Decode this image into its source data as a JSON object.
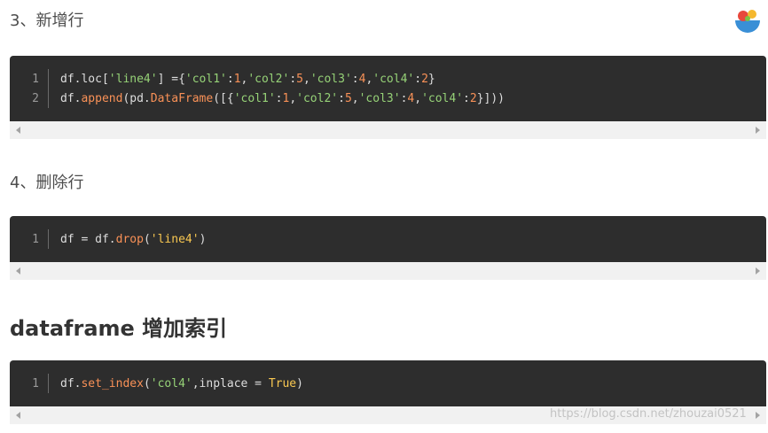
{
  "headings": {
    "step3": "3、新增行",
    "step4": "4、删除行",
    "section_index": "dataframe 增加索引"
  },
  "code_blocks": [
    {
      "lines": [
        {
          "number": "1",
          "tokens": [
            {
              "t": "df.loc[",
              "k": "plain"
            },
            {
              "t": "'line4'",
              "k": "str"
            },
            {
              "t": "] ={",
              "k": "plain"
            },
            {
              "t": "'col1'",
              "k": "str"
            },
            {
              "t": ":",
              "k": "plain"
            },
            {
              "t": "1",
              "k": "num"
            },
            {
              "t": ",",
              "k": "plain"
            },
            {
              "t": "'col2'",
              "k": "str"
            },
            {
              "t": ":",
              "k": "plain"
            },
            {
              "t": "5",
              "k": "num"
            },
            {
              "t": ",",
              "k": "plain"
            },
            {
              "t": "'col3'",
              "k": "str"
            },
            {
              "t": ":",
              "k": "plain"
            },
            {
              "t": "4",
              "k": "num"
            },
            {
              "t": ",",
              "k": "plain"
            },
            {
              "t": "'col4'",
              "k": "str"
            },
            {
              "t": ":",
              "k": "plain"
            },
            {
              "t": "2",
              "k": "num"
            },
            {
              "t": "}",
              "k": "plain"
            }
          ]
        },
        {
          "number": "2",
          "tokens": [
            {
              "t": "df.",
              "k": "plain"
            },
            {
              "t": "append",
              "k": "fn"
            },
            {
              "t": "(pd.",
              "k": "plain"
            },
            {
              "t": "DataFrame",
              "k": "fn"
            },
            {
              "t": "([{",
              "k": "plain"
            },
            {
              "t": "'col1'",
              "k": "str"
            },
            {
              "t": ":",
              "k": "plain"
            },
            {
              "t": "1",
              "k": "num"
            },
            {
              "t": ",",
              "k": "plain"
            },
            {
              "t": "'col2'",
              "k": "str"
            },
            {
              "t": ":",
              "k": "plain"
            },
            {
              "t": "5",
              "k": "num"
            },
            {
              "t": ",",
              "k": "plain"
            },
            {
              "t": "'col3'",
              "k": "str"
            },
            {
              "t": ":",
              "k": "plain"
            },
            {
              "t": "4",
              "k": "num"
            },
            {
              "t": ",",
              "k": "plain"
            },
            {
              "t": "'col4'",
              "k": "str"
            },
            {
              "t": ":",
              "k": "plain"
            },
            {
              "t": "2",
              "k": "num"
            },
            {
              "t": "}]))",
              "k": "plain"
            }
          ]
        }
      ]
    },
    {
      "lines": [
        {
          "number": "1",
          "tokens": [
            {
              "t": "df = df.",
              "k": "plain"
            },
            {
              "t": "drop",
              "k": "fn"
            },
            {
              "t": "(",
              "k": "plain"
            },
            {
              "t": "'line4'",
              "k": "kw"
            },
            {
              "t": ")",
              "k": "plain"
            }
          ]
        }
      ]
    },
    {
      "lines": [
        {
          "number": "1",
          "tokens": [
            {
              "t": "df.",
              "k": "plain"
            },
            {
              "t": "set_index",
              "k": "fn"
            },
            {
              "t": "(",
              "k": "plain"
            },
            {
              "t": "'col4'",
              "k": "str"
            },
            {
              "t": ",inplace = ",
              "k": "plain"
            },
            {
              "t": "True",
              "k": "kw"
            },
            {
              "t": ")",
              "k": "plain"
            }
          ]
        }
      ]
    }
  ],
  "watermark": "https://blog.csdn.net/zhouzai0521",
  "icons": {
    "logo": "csdn-bowl-logo-icon",
    "scroll_left": "scroll-left-arrow-icon",
    "scroll_right": "scroll-right-arrow-icon"
  },
  "colors": {
    "code_bg": "#2d2d2d",
    "string": "#96d277",
    "number": "#f99157",
    "keyword": "#f9c851"
  }
}
